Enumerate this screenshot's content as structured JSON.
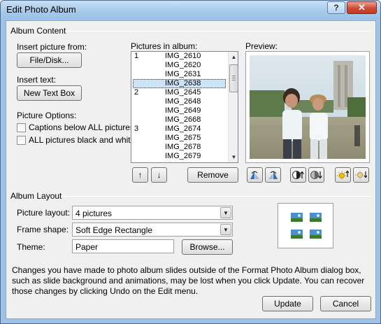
{
  "window": {
    "title": "Edit Photo Album",
    "help": "?",
    "close": "✕"
  },
  "album_content": {
    "group_label": "Album Content",
    "insert_picture_label": "Insert picture from:",
    "file_disk_button": "File/Disk...",
    "insert_text_label": "Insert text:",
    "new_text_box_button": "New Text Box",
    "picture_options_label": "Picture Options:",
    "captions_checkbox": {
      "label": "Captions below ALL pictures",
      "checked": false
    },
    "black_white_checkbox": {
      "label": "ALL pictures black and white",
      "checked": false
    },
    "pictures_label": "Pictures in album:",
    "pictures": [
      {
        "group": "1",
        "name": "IMG_2610"
      },
      {
        "group": "",
        "name": "IMG_2620"
      },
      {
        "group": "",
        "name": "IMG_2631"
      },
      {
        "group": "",
        "name": "IMG_2638",
        "selected": true
      },
      {
        "group": "2",
        "name": "IMG_2645"
      },
      {
        "group": "",
        "name": "IMG_2648"
      },
      {
        "group": "",
        "name": "IMG_2649"
      },
      {
        "group": "",
        "name": "IMG_2668"
      },
      {
        "group": "3",
        "name": "IMG_2674"
      },
      {
        "group": "",
        "name": "IMG_2675"
      },
      {
        "group": "",
        "name": "IMG_2678"
      },
      {
        "group": "",
        "name": "IMG_2679"
      }
    ],
    "move_up_icon": "↑",
    "move_down_icon": "↓",
    "remove_button": "Remove",
    "preview_label": "Preview:",
    "tool_icons": [
      "rotate-left-icon",
      "rotate-right-icon",
      "contrast-up-icon",
      "contrast-down-icon",
      "brightness-up-icon",
      "brightness-down-icon"
    ]
  },
  "album_layout": {
    "group_label": "Album Layout",
    "picture_layout_label": "Picture layout:",
    "picture_layout_value": "4 pictures",
    "frame_shape_label": "Frame shape:",
    "frame_shape_value": "Soft Edge Rectangle",
    "theme_label": "Theme:",
    "theme_value": "Paper",
    "browse_button": "Browse..."
  },
  "note": "Changes you have made to photo album slides outside of the Format Photo Album dialog box, such as slide background and animations, may be lost when you click Update. You can recover those changes by clicking Undo on the Edit menu.",
  "footer": {
    "update_button": "Update",
    "cancel_button": "Cancel"
  },
  "colors": {
    "titlebar": "#a9cbeb",
    "dialog_bg": "#f0f0f0",
    "selection": "#cde3f9",
    "close": "#c33a22"
  }
}
